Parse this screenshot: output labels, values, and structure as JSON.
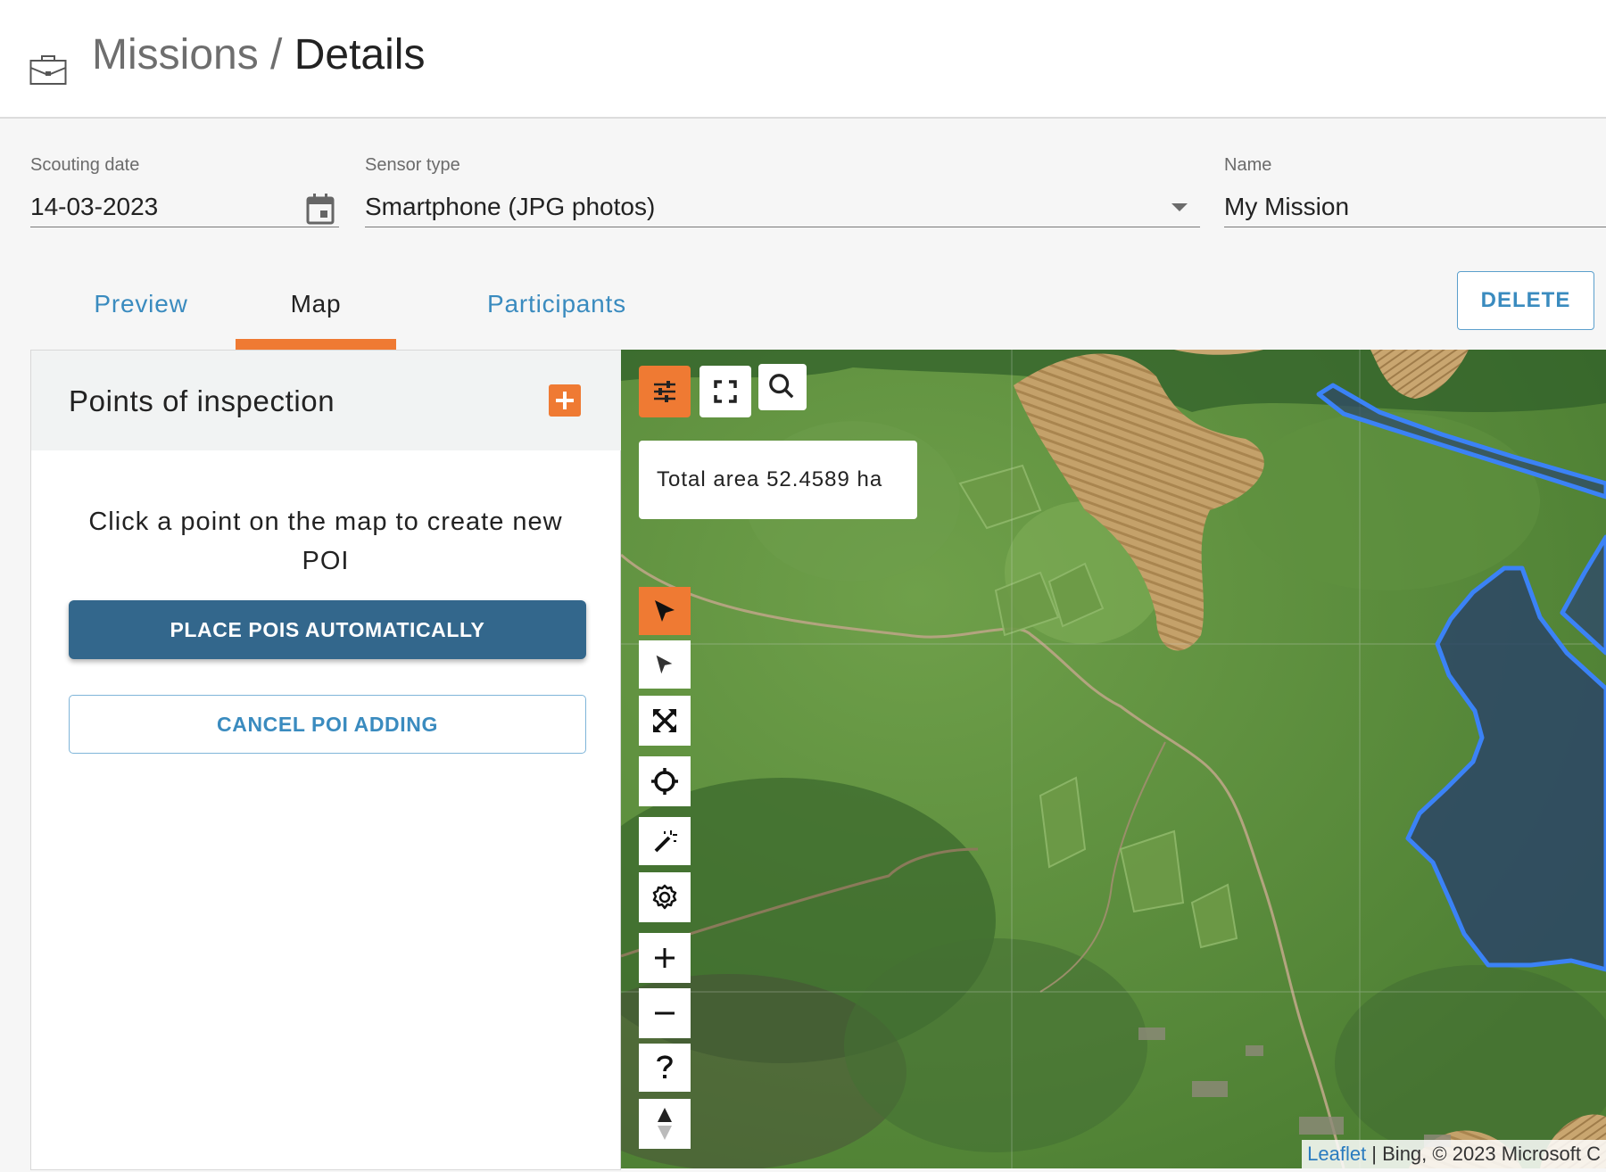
{
  "header": {
    "crumb_root": "Missions",
    "separator": " / ",
    "crumb_current": "Details",
    "icon": "briefcase-icon"
  },
  "form": {
    "date": {
      "label": "Scouting date",
      "value": "14-03-2023"
    },
    "sensor": {
      "label": "Sensor type",
      "value": "Smartphone (JPG photos)"
    },
    "name": {
      "label": "Name",
      "value": "My Mission"
    }
  },
  "tabs": [
    {
      "label": "Preview",
      "active": false
    },
    {
      "label": "Map",
      "active": true
    },
    {
      "label": "Participants",
      "active": false
    }
  ],
  "actions": {
    "delete_label": "DELETE"
  },
  "poi_panel": {
    "title": "Points of inspection",
    "message": "Click a point on the map to create new POI",
    "place_label": "PLACE POIS AUTOMATICALLY",
    "cancel_label": "CANCEL POI ADDING"
  },
  "map": {
    "area_label": "Total area",
    "area_value": "52.4589 ha",
    "attribution_link": "Leaflet",
    "attribution_text": " | Bing, © 2023 Microsoft C",
    "colors": {
      "accent": "#ef7a33",
      "polygon": "#3b82f6",
      "primary": "#33678c"
    }
  }
}
